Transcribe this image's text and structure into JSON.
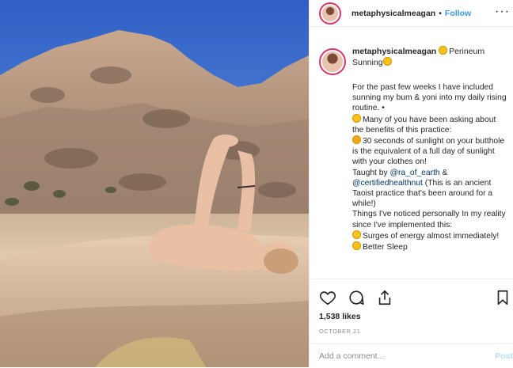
{
  "header": {
    "username": "metaphysicalmeagan",
    "separator": "•",
    "follow_label": "Follow",
    "more_label": "···"
  },
  "caption": {
    "username": "metaphysicalmeagan",
    "title": "Perineum Sunning",
    "paragraph1": "For the past few weeks I have included sunning my bum & yoni into my daily rising routine. •",
    "paragraph2": "Many of you have been asking about the benefits of this practice:",
    "paragraph3": "30 seconds of sunlight on your butthole is the equivalent of a full day of sunlight with your clothes on!",
    "taught_by": "Taught by",
    "mention1": "@ra_of_earth",
    "amp": "&",
    "mention2": "@certifiedhealthnut",
    "paragraph4": "(This is an ancient Taoist practice that's been around for a while!)",
    "paragraph5": "Things I've noticed personally In my reality since I've implemented this:",
    "bullet1": "Surges of energy almost immediately!",
    "bullet2": "Better Sleep"
  },
  "actions": {
    "icons": [
      "heart-icon",
      "comment-icon",
      "share-icon",
      "bookmark-icon"
    ]
  },
  "likes": "1,538 likes",
  "date": "OCTOBER 21",
  "comment_input": {
    "placeholder": "Add a comment...",
    "post_label": "Post"
  }
}
